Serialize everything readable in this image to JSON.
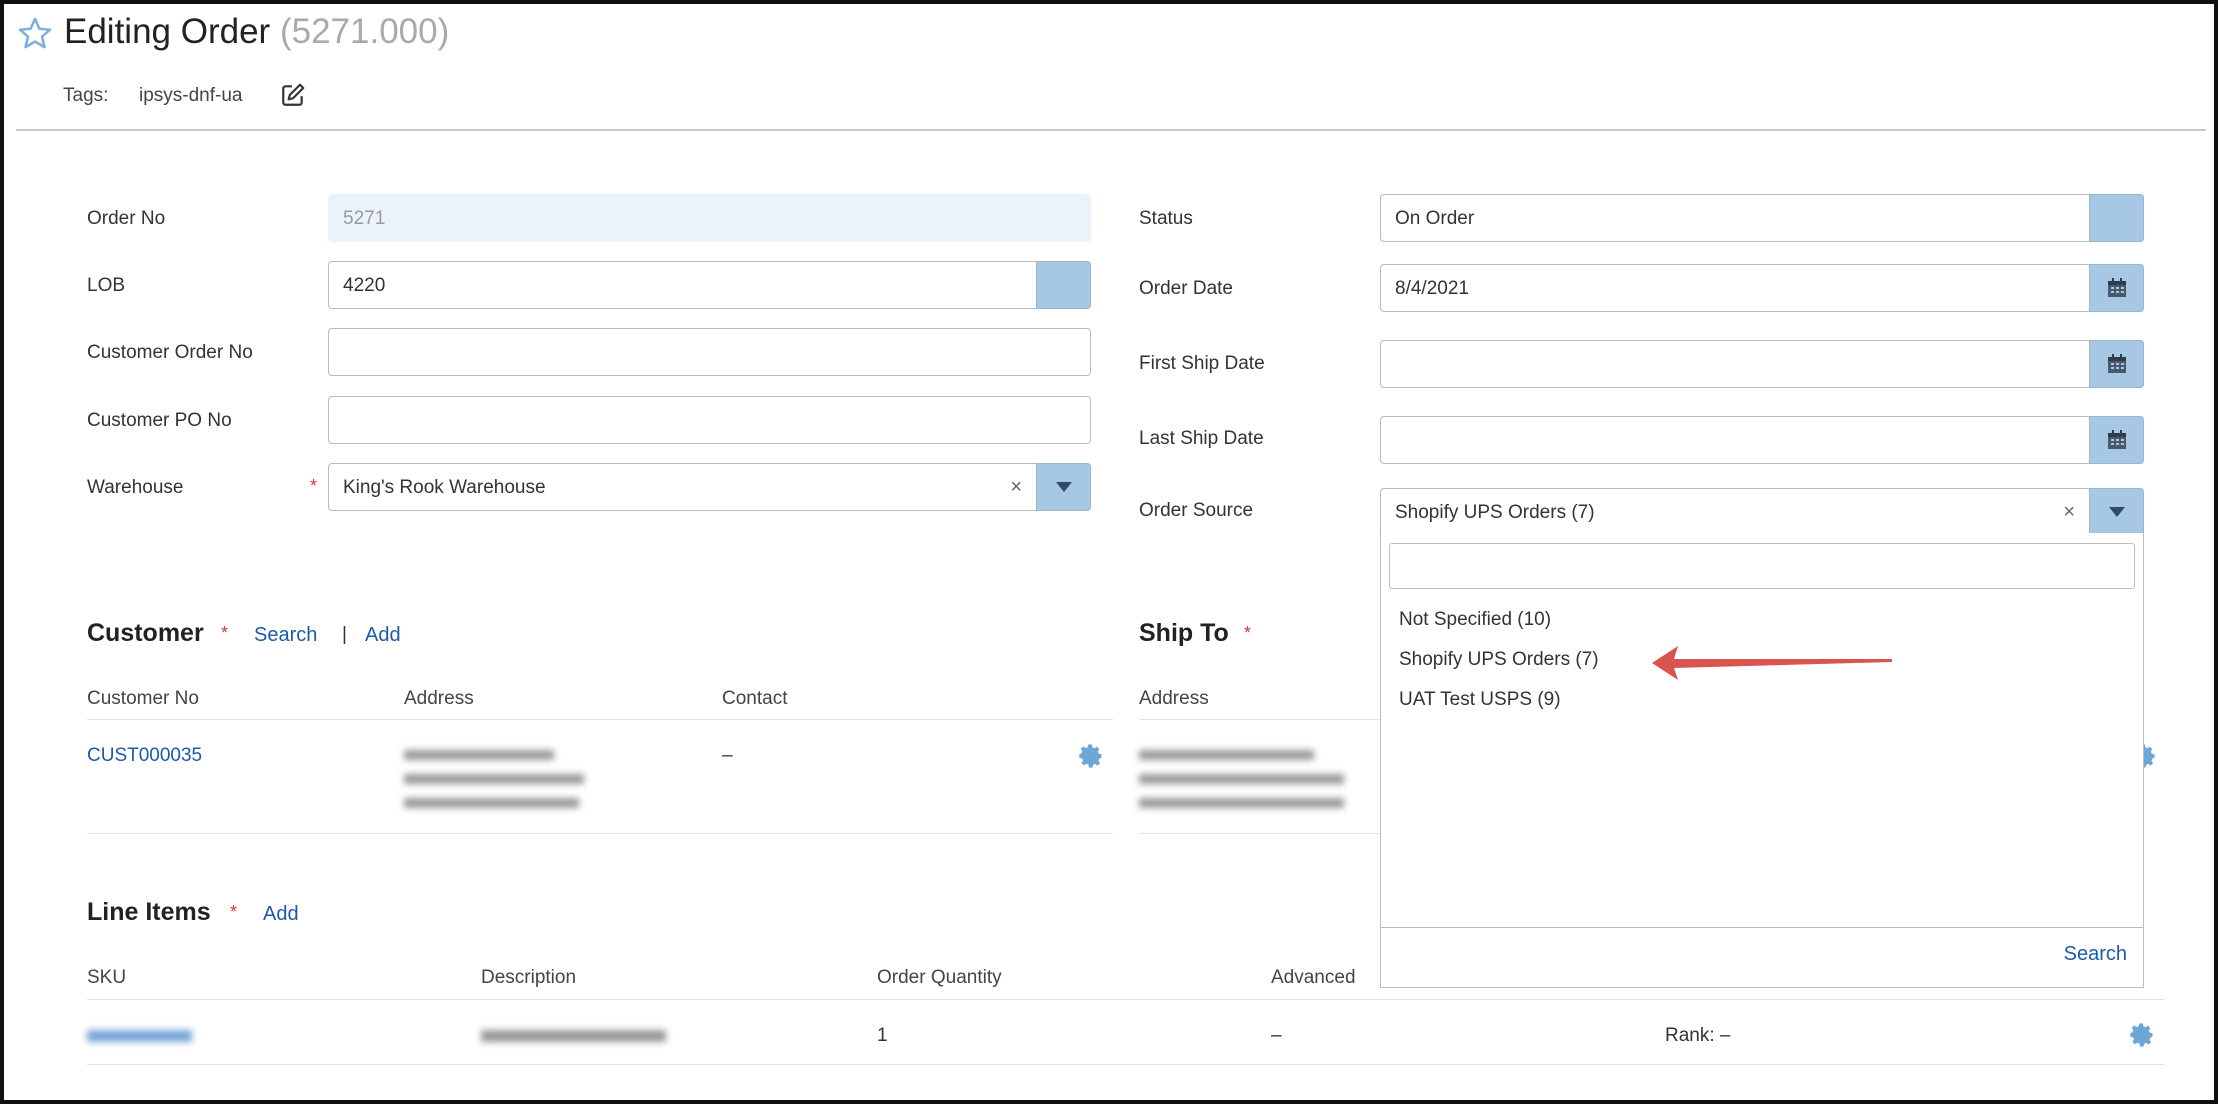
{
  "header": {
    "title": "Editing Order",
    "title_number": "(5271.000)",
    "tags_label": "Tags:",
    "tag": "ipsys-dnf-ua"
  },
  "form": {
    "order_no": {
      "label": "Order No",
      "value": "5271"
    },
    "lob": {
      "label": "LOB",
      "value": "4220"
    },
    "customer_order_no": {
      "label": "Customer Order No",
      "value": ""
    },
    "customer_po_no": {
      "label": "Customer PO No",
      "value": ""
    },
    "warehouse": {
      "label": "Warehouse",
      "value": "King's Rook Warehouse",
      "required": "*"
    },
    "status": {
      "label": "Status",
      "value": "On Order"
    },
    "order_date": {
      "label": "Order Date",
      "value": "8/4/2021"
    },
    "first_ship_date": {
      "label": "First Ship Date",
      "value": ""
    },
    "last_ship_date": {
      "label": "Last Ship Date",
      "value": ""
    },
    "order_source": {
      "label": "Order Source",
      "value": "Shopify UPS Orders (7)"
    }
  },
  "customer": {
    "title": "Customer",
    "required": "*",
    "search_link": "Search",
    "separator": "|",
    "add_link": "Add",
    "columns": [
      "Customer No",
      "Address",
      "Contact"
    ],
    "row": {
      "customer_no": "CUST000035",
      "contact": "–"
    }
  },
  "ship_to": {
    "title": "Ship To",
    "required": "*",
    "columns": [
      "Address"
    ]
  },
  "line_items": {
    "title": "Line Items",
    "required": "*",
    "add_link": "Add",
    "columns": [
      "SKU",
      "Description",
      "Order Quantity",
      "Advanced"
    ],
    "row": {
      "order_quantity": "1",
      "advanced": "–",
      "rank": "Rank: –"
    }
  },
  "order_source_dropdown": {
    "search_value": "",
    "options": [
      "Not Specified (10)",
      "Shopify UPS Orders (7)",
      "UAT Test USPS (9)"
    ],
    "footer_search": "Search"
  },
  "colors": {
    "accent_blue": "#1e5aa8",
    "addon_blue": "#a6c8e4",
    "required_red": "#d33333",
    "arrow_red": "#d9534f",
    "readonly_bg": "#eaf3fb"
  },
  "icons": [
    "star-icon",
    "edit-icon",
    "calendar-icon",
    "chevron-down-icon",
    "clear-icon",
    "gear-icon",
    "red-arrow-annotation"
  ]
}
